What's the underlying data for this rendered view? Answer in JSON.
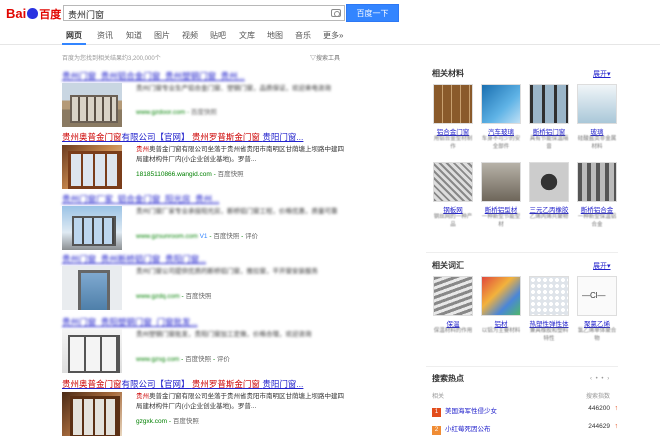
{
  "logo": {
    "text_left": "Bai",
    "text_right": "百度"
  },
  "search": {
    "query": "贵州门窗",
    "button": "百度一下"
  },
  "nav": {
    "tabs": [
      "网页",
      "资讯",
      "知道",
      "图片",
      "视频",
      "贴吧",
      "文库",
      "地图",
      "音乐",
      "更多»"
    ],
    "active": "网页"
  },
  "result_count": "百度为您找到相关结果约3,200,000个",
  "search_tools": "搜索工具",
  "results": [
    {
      "title": "贵州门窗_贵州铝合金门窗_贵州塑钢门窗_贵州...",
      "desc": "贵州门窗专业生产铝合金门窗、塑钢门窗，品质保证，欢迎来电咨询",
      "url": "www.gzdoor.com",
      "cache": "百度快照"
    },
    {
      "title_hl": "贵州奥普金门窗",
      "title_rest": "有限公司【官网】",
      "title_2": "贵州罗普斯金",
      "title_3": "门窗",
      "title_4": "贵阳门窗...",
      "desc_hl": "贵州",
      "desc": "奥普金门窗有限公司坐落于贵州省贵阳市南明区甘荫塘上坝路中建四局建材构件厂内(小企业创业基地)。罗普...",
      "url": "18185110866.wangid.com",
      "cache": "百度快照"
    },
    {
      "title": "贵州门窗厂家_铝合金门窗_阳光房_贵州...",
      "desc": "贵州门窗厂家专业承接阳光房，断桥铝门窗工程，价格优惠，质量可靠",
      "url": "www.gzsunroom.com",
      "v": "V1",
      "cache": "百度快照",
      "eval": "评价"
    },
    {
      "title": "贵州门窗_贵州断桥铝门窗_贵阳门窗...",
      "desc": "贵州门窗公司提供优质的断桥铝门窗，推拉窗，平开窗安装服务",
      "url": "www.gzdq.com",
      "cache": "百度快照"
    },
    {
      "title": "贵州门窗_贵阳塑钢门窗_门窗批发...",
      "desc": "贵州塑钢门窗批发，贵阳门窗加工定做，价格合理，欢迎咨询",
      "url": "www.gzsg.com",
      "cache": "百度快照",
      "eval": "评价"
    },
    {
      "title_hl": "贵州奥普金门窗",
      "title_rest": "有限公司【官网】",
      "title_2": "贵州罗普斯金",
      "title_3": "门窗",
      "title_4": "贵阳门窗...",
      "desc_hl": "贵州",
      "desc": "奥普金门窗有限公司坐落于贵州省贵阳市南明区甘荫塘上坝路中建四局建材构件厂内(小企业创业基地)。罗普...",
      "url": "gzgxk.com",
      "cache": "百度快照"
    }
  ],
  "materials": {
    "title": "相关材料",
    "more": "展开",
    "items": [
      {
        "name": "铝合金门窗",
        "sub": "用铝合金型材制作"
      },
      {
        "name": "汽车玻璃",
        "sub": "车身不可少的安全部件"
      },
      {
        "name": "断桥铝门窗",
        "sub": "具有节能保温隔音"
      },
      {
        "name": "玻璃",
        "sub": "硅酸盐类非金属材料"
      },
      {
        "name": "钢板网",
        "sub": "钢丝网的一种产品"
      },
      {
        "name": "断桥铝型材",
        "sub": "一种新型节能型材"
      },
      {
        "name": "三元乙丙橡胶",
        "sub": "乙烯丙烯共聚物"
      },
      {
        "name": "断桥铝合金",
        "sub": "一种新型保温铝合金"
      }
    ]
  },
  "words": {
    "title": "相关词汇",
    "more": "展开",
    "items": [
      {
        "name": "保温",
        "sub": "保温材料的作用"
      },
      {
        "name": "铝材",
        "sub": "以铝为主要材料"
      },
      {
        "name": "热塑性弹性体",
        "sub": "兼具橡胶和塑料特性"
      },
      {
        "name": "聚氯乙烯",
        "sub": "氯乙烯单体聚合物"
      }
    ]
  },
  "hot": {
    "title": "搜索热点",
    "col_left": "相关",
    "col_right": "搜索指数",
    "items": [
      {
        "rank": "1",
        "name": "美国海军性侵少女",
        "value": "446200",
        "color": "#e24c1b"
      },
      {
        "rank": "2",
        "name": "小红莓死因公布",
        "value": "244629",
        "color": "#f08c34"
      }
    ]
  }
}
